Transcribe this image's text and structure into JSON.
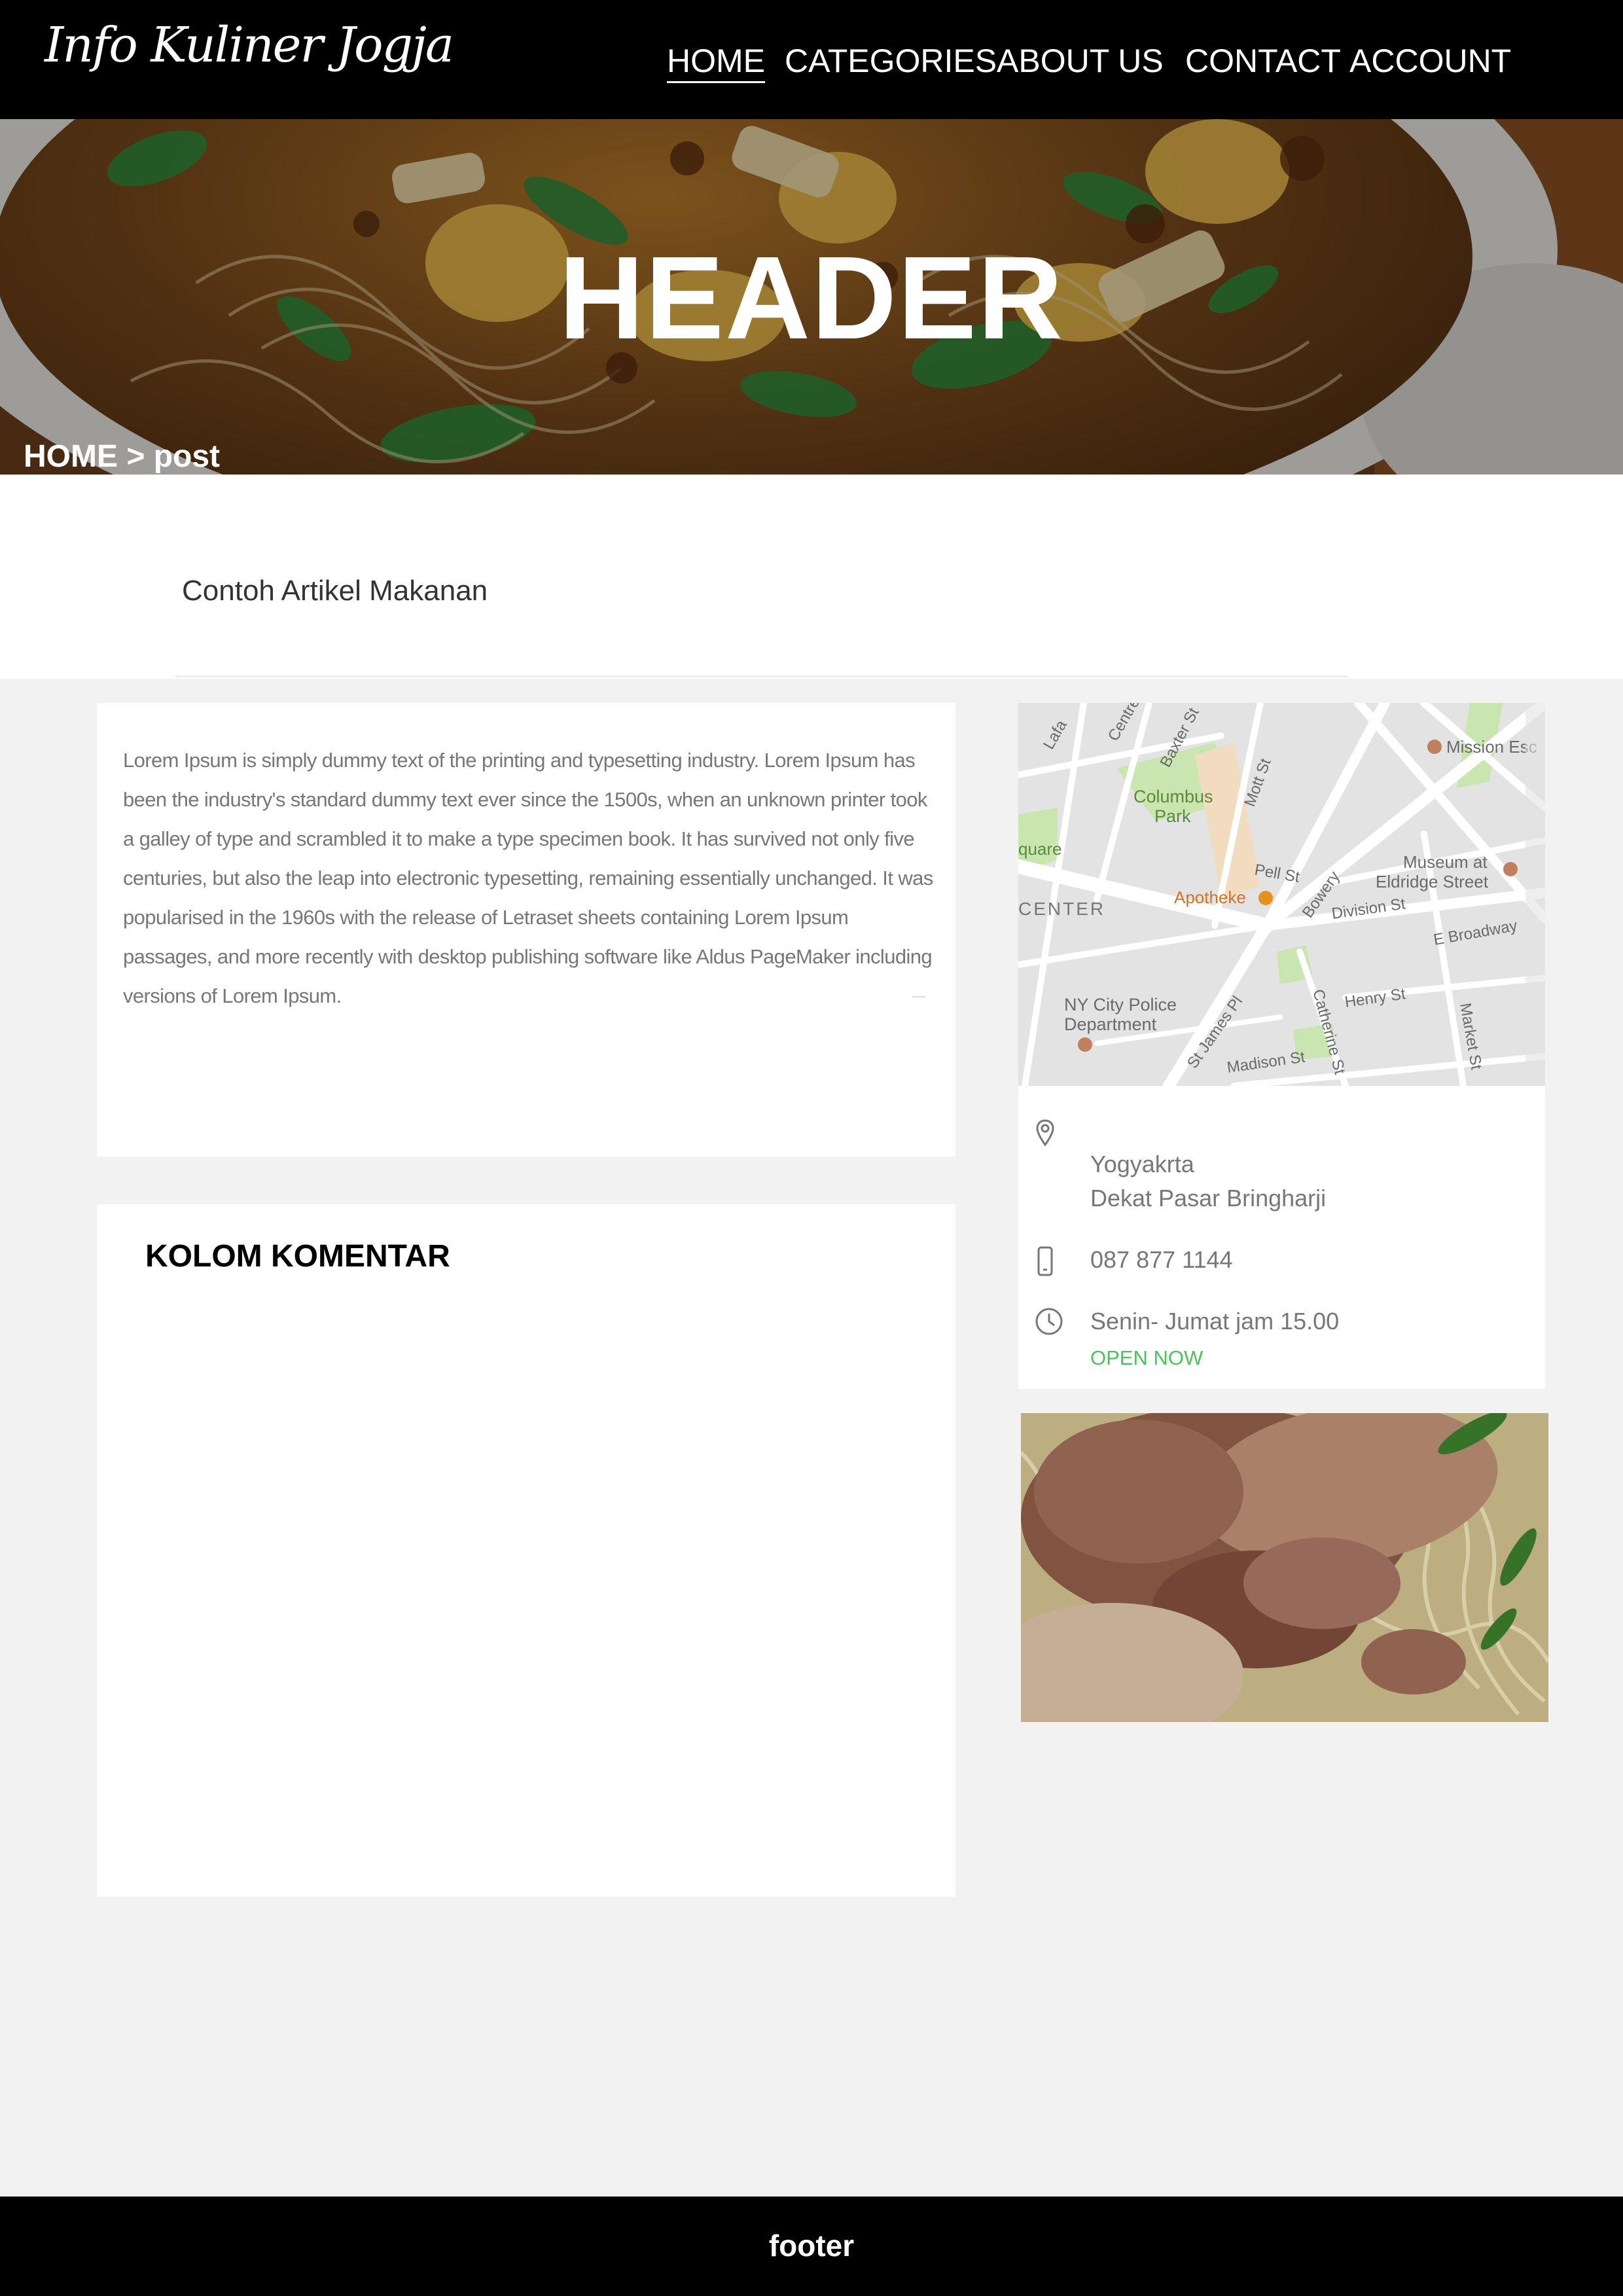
{
  "nav": {
    "logo": "Info Kuliner Jogja",
    "items": [
      "HOME",
      "CATEGORIES",
      "ABOUT US",
      "CONTACT",
      "ACCOUNT"
    ]
  },
  "hero": {
    "title": "HEADER",
    "breadcrumb": "HOME > post"
  },
  "article": {
    "title": "Contoh Artikel Makanan",
    "body": "Lorem Ipsum is simply dummy text of the printing and typesetting industry. Lorem Ipsum has been the industry's standard dummy text ever since the 1500s, when an unknown printer took a galley of type and scrambled it to make a type specimen book. It has survived not only five centuries, but also the leap into electronic typesetting, remaining essentially unchanged. It was popularised in the 1960s with the release of Letraset sheets containing Lorem Ipsum passages, and more recently with desktop publishing software like Aldus PageMaker including versions of Lorem Ipsum."
  },
  "comments": {
    "title": "KOLOM KOMENTAR"
  },
  "map": {
    "labels": {
      "columbus_park": "Columbus Park",
      "mission": "Mission Esc",
      "museum": "Museum at Eldridge Street",
      "apotheke": "Apotheke",
      "center": "CENTER",
      "quare": "quare",
      "pell": "Pell St",
      "mott": "Mott St",
      "baxter": "Baxter St",
      "centre": "Centre St",
      "bowery": "Bowery",
      "division": "Division St",
      "broadway": "E Broadway",
      "police": "NY City Police Department",
      "henry": "Henry St",
      "catherine": "Catherine St",
      "market": "Market St",
      "madison": "Madison St",
      "james": "St James Pl",
      "lafa": "Lafa"
    },
    "address_line1": "Yogyakrta",
    "address_line2": "Dekat Pasar Bringharji",
    "phone": "087 877 1144",
    "hours": "Senin- Jumat jam 15.00",
    "status": "OPEN NOW"
  },
  "footer": {
    "text": "footer"
  },
  "colors": {
    "open_now": "#4cc35a",
    "nav_bg": "#000000",
    "page_bg": "#f2f2f2"
  },
  "icons": {
    "address": "location-pin-icon",
    "phone": "mobile-phone-icon",
    "hours": "clock-icon"
  }
}
